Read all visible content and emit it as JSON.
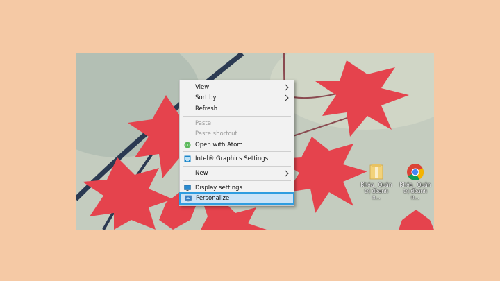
{
  "context_menu": {
    "items": [
      {
        "label": "View"
      },
      {
        "label": "Sort by"
      },
      {
        "label": "Refresh"
      },
      {
        "label": "Paste"
      },
      {
        "label": "Paste shortcut"
      },
      {
        "label": "Open with Atom"
      },
      {
        "label": "Intel® Graphics Settings"
      },
      {
        "label": "New"
      },
      {
        "label": "Display settings"
      },
      {
        "label": "Personalize"
      }
    ]
  },
  "desktop_icons": [
    {
      "caption_line1": "Khóa_ Quản",
      "caption_line2": "trị doanh n...",
      "icon": "folder-icon"
    },
    {
      "caption_line1": "Khóa_ Quản",
      "caption_line2": "trị doanh n...",
      "icon": "chrome-icon"
    }
  ],
  "colors": {
    "background": "#f5c9a5",
    "highlight": "#2f9de0",
    "leaf": "#e5434d"
  }
}
